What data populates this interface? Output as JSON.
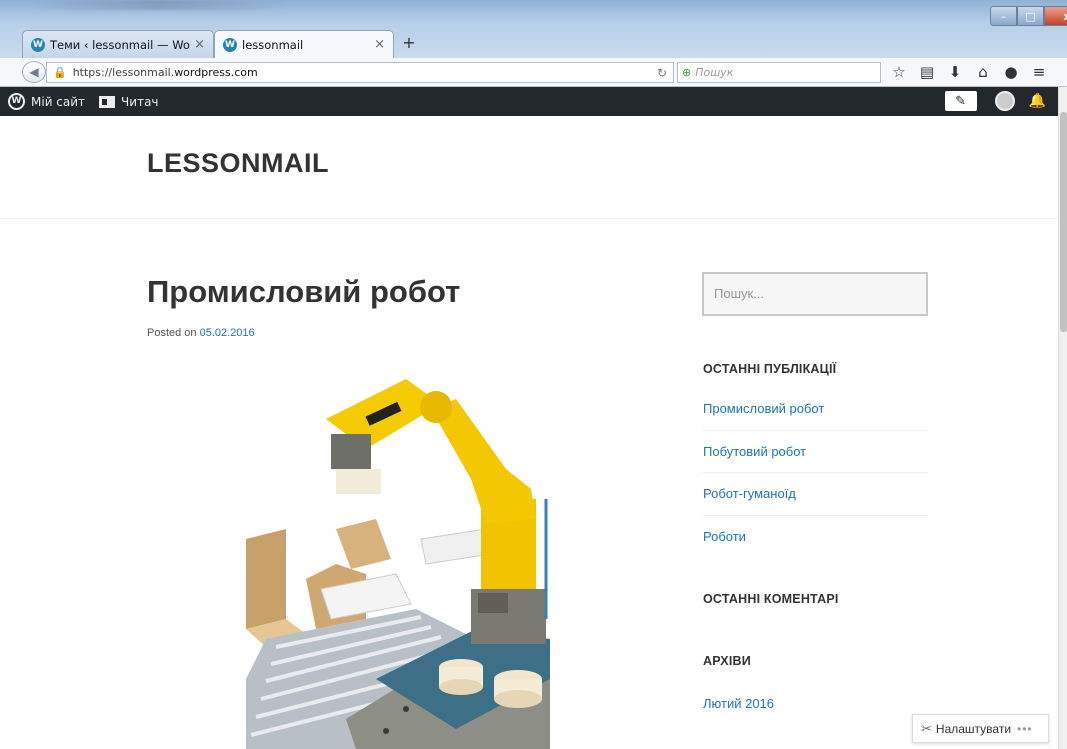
{
  "browser": {
    "tabs": [
      {
        "label": "Теми ‹ lessonmail — Word...",
        "close": "×"
      },
      {
        "label": "lessonmail",
        "close": "×"
      }
    ],
    "new_tab": "+",
    "window_controls": {
      "minimize": "–",
      "maximize": "□",
      "close": "x"
    },
    "url": {
      "prefix": "https://lessonmail.",
      "host": "wordpress.com"
    },
    "search_placeholder": "Пошук"
  },
  "adminbar": {
    "my_site": "Мій сайт",
    "reader": "Читач"
  },
  "site": {
    "title": "LESSONMAIL"
  },
  "post": {
    "title": "Промисловий робот",
    "posted_on": "Posted on",
    "date": "05.02.2016"
  },
  "sidebar": {
    "search_placeholder": "Пошук...",
    "recent_posts_title": "ОСТАННІ ПУБЛІКАЦІЇ",
    "recent_posts": [
      "Промисловий робот",
      "Побутовий робот",
      "Робот-гуманоїд",
      "Роботи"
    ],
    "recent_comments_title": "ОСТАННІ КОМЕНТАРІ",
    "archives_title": "АРХІВИ",
    "archives": [
      "Лютий 2016"
    ]
  },
  "customize": {
    "label": "Налаштувати",
    "more": "•••"
  },
  "colors": {
    "link": "#1e73be",
    "adminbar": "#23282d",
    "robot_yellow": "#f2c500"
  }
}
